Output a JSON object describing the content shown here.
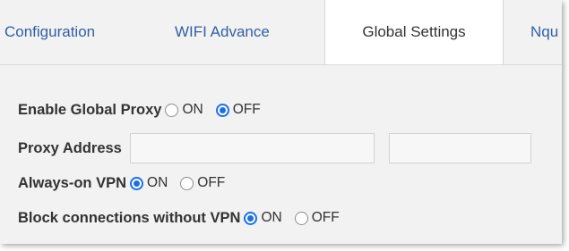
{
  "tabs": [
    {
      "label": "Configuration"
    },
    {
      "label": "WIFI Advance"
    },
    {
      "label": "Global Settings"
    },
    {
      "label": "Nqu"
    }
  ],
  "settings": {
    "global_proxy": {
      "label": "Enable Global Proxy",
      "on_label": "ON",
      "off_label": "OFF",
      "selected": "OFF"
    },
    "proxy_address": {
      "label": "Proxy Address",
      "host_value": "",
      "port_value": ""
    },
    "always_on_vpn": {
      "label": "Always-on VPN",
      "on_label": "ON",
      "off_label": "OFF",
      "selected": "ON"
    },
    "block_without_vpn": {
      "label": "Block connections without VPN",
      "on_label": "ON",
      "off_label": "OFF",
      "selected": "ON"
    }
  },
  "colors": {
    "accent": "#1a6fe8",
    "tab_link": "#2f5fa6",
    "panel_bg": "#f2f2f2"
  }
}
